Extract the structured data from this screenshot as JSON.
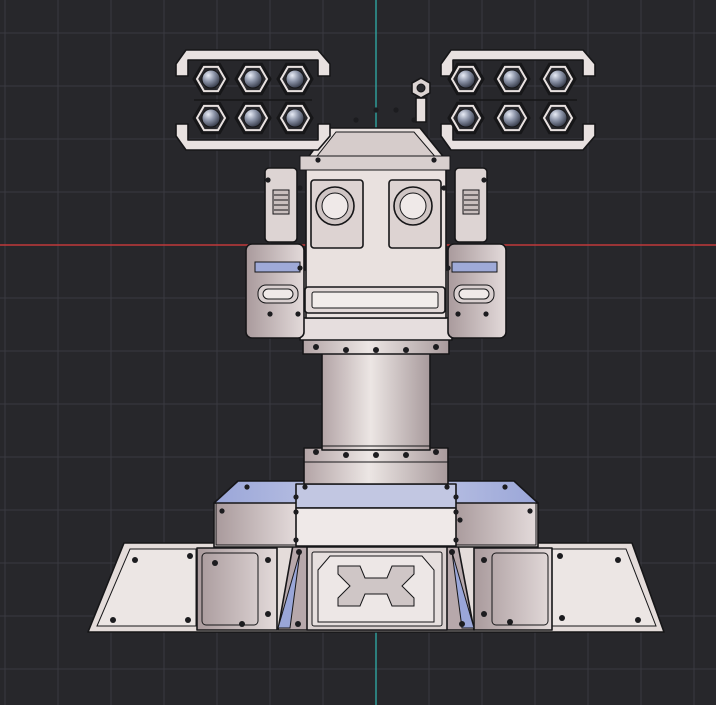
{
  "viewport": {
    "background": "#27272b",
    "axis_x_color": "#c0393b",
    "axis_y_color": "#2fa3a0",
    "grid_color": "#3a3a40",
    "model": {
      "base_color": "#e6dedc",
      "shade_color": "#b6a6a6",
      "highlight_color": "#a8b4e0",
      "outline_color": "#161618",
      "sphere_color": "#8f96a8"
    }
  }
}
